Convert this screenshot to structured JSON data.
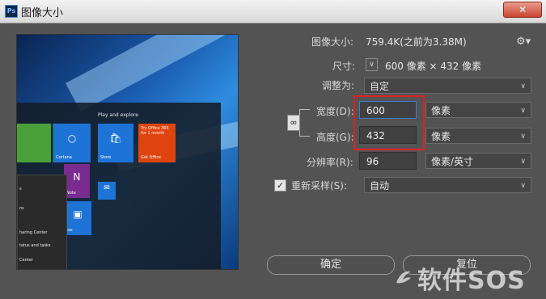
{
  "window": {
    "title": "图像大小",
    "close_label": "✕"
  },
  "info": {
    "image_size_label": "图像大小:",
    "image_size_value": "759.4K(之前为3.38M)",
    "dimensions_label": "尺寸:",
    "dimensions_value": "600 像素  ×  432 像素",
    "fit_label": "调整为:",
    "fit_value": "自定"
  },
  "size": {
    "width_label": "宽度(D):",
    "width_value": "600",
    "width_unit": "像素",
    "height_label": "高度(G):",
    "height_value": "432",
    "height_unit": "像素",
    "resolution_label": "分辨率(R):",
    "resolution_value": "96",
    "resolution_unit": "像素/英寸"
  },
  "resample": {
    "checked": true,
    "label": "重新采样(S):",
    "value": "自动"
  },
  "buttons": {
    "ok": "确定",
    "reset": "复位"
  },
  "watermark": {
    "text": "软件SOS"
  },
  "preview": {
    "header": "Play and explore",
    "tiles": [
      {
        "label": "Cortana"
      },
      {
        "label": "Store"
      },
      {
        "label": "Try Office 365 for 1 month"
      },
      {
        "label": "Get Office"
      },
      {
        "label": "Note"
      }
    ],
    "menu_items": [
      "s",
      "ns",
      "haring Center",
      "tatus and tasks",
      "Center"
    ],
    "os": "tos"
  },
  "icons": {
    "gear": "gear-icon",
    "link": "link-icon",
    "chevron": "chevron-down-icon",
    "check": "check-icon"
  },
  "colors": {
    "highlight": "#e21f1f",
    "accent_field": "#3d7cc9",
    "dialog_bg": "#535353"
  }
}
